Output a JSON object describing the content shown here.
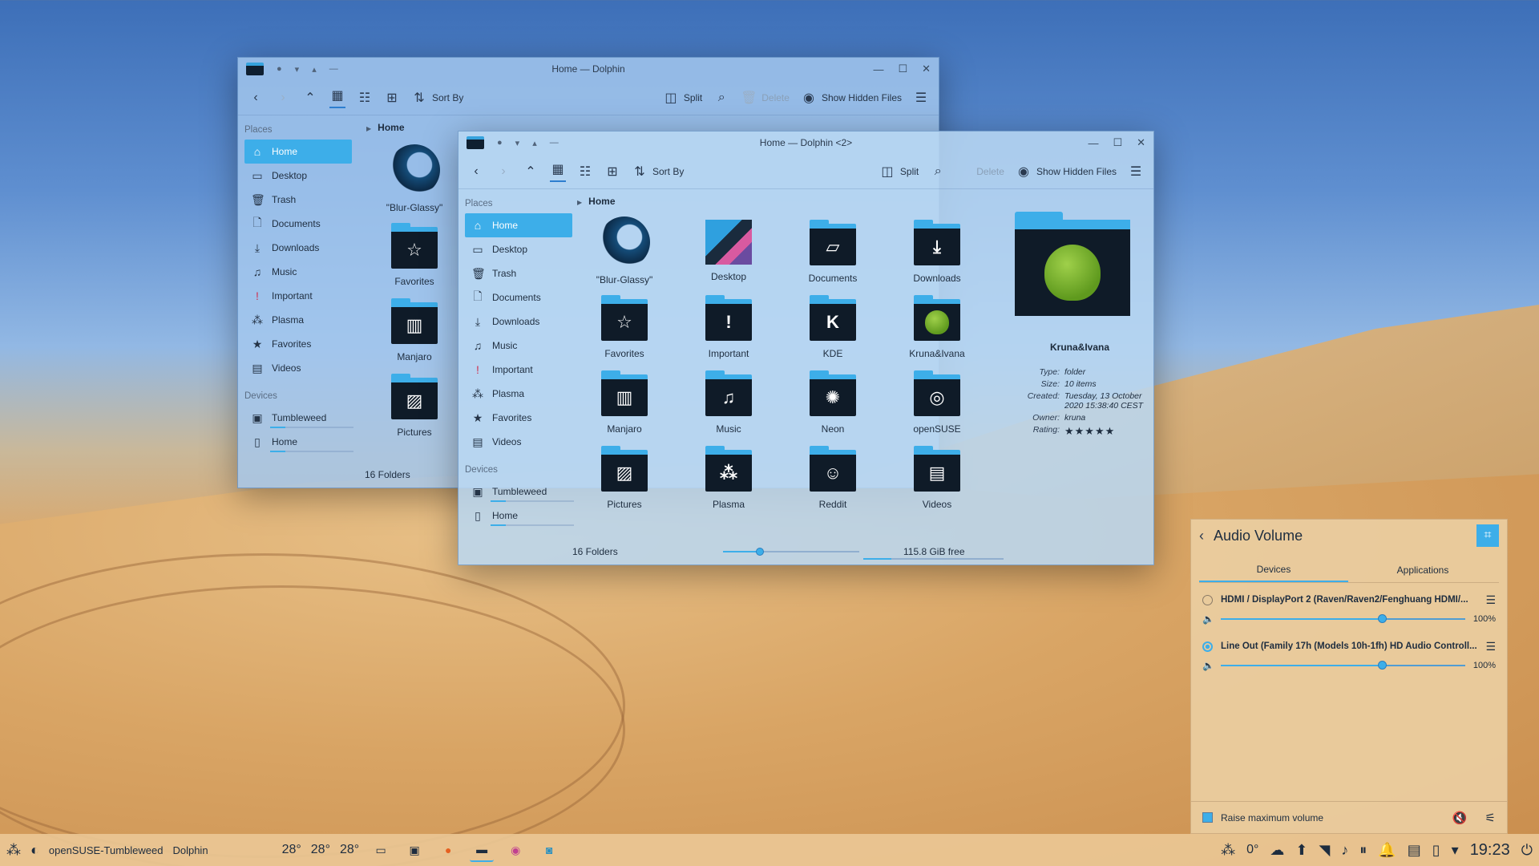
{
  "back_window": {
    "title": "Home — Dolphin",
    "toolbar": {
      "sort_by": "Sort By",
      "split": "Split",
      "delete": "Delete",
      "show_hidden": "Show Hidden Files"
    },
    "places_title": "Places",
    "places": [
      "Home",
      "Desktop",
      "Trash",
      "Documents",
      "Downloads",
      "Music",
      "Important",
      "Plasma",
      "Favorites",
      "Videos"
    ],
    "devices_title": "Devices",
    "devices": [
      "Tumbleweed",
      "Home"
    ],
    "breadcrumb": "Home",
    "items": [
      "\"Blur-Glassy\"",
      "Favorites",
      "Manjaro",
      "Pictures"
    ],
    "status": "16 Folders"
  },
  "front_window": {
    "title": "Home — Dolphin <2>",
    "toolbar": {
      "sort_by": "Sort By",
      "split": "Split",
      "delete": "Delete",
      "show_hidden": "Show Hidden Files"
    },
    "places_title": "Places",
    "places": [
      "Home",
      "Desktop",
      "Trash",
      "Documents",
      "Downloads",
      "Music",
      "Important",
      "Plasma",
      "Favorites",
      "Videos"
    ],
    "devices_title": "Devices",
    "devices": [
      "Tumbleweed",
      "Home"
    ],
    "breadcrumb": "Home",
    "items": [
      "\"Blur-Glassy\"",
      "Desktop",
      "Documents",
      "Downloads",
      "Favorites",
      "Important",
      "KDE",
      "Kruna&Ivana",
      "Manjaro",
      "Music",
      "Neon",
      "openSUSE",
      "Pictures",
      "Plasma",
      "Reddit",
      "Videos"
    ],
    "status": "16 Folders",
    "free_space": "115.8 GiB free",
    "info": {
      "name": "Kruna&Ivana",
      "type_label": "Type:",
      "type": "folder",
      "size_label": "Size:",
      "size": "10 items",
      "created_label": "Created:",
      "created": "Tuesday, 13 October 2020 15:38:40 CEST",
      "owner_label": "Owner:",
      "owner": "kruna",
      "rating_label": "Rating:",
      "rating": 5
    }
  },
  "audio": {
    "title": "Audio Volume",
    "tabs": [
      "Devices",
      "Applications"
    ],
    "devices": [
      {
        "name": "HDMI / DisplayPort 2 (Raven/Raven2/Fenghuang HDMI/...",
        "volume": "100%",
        "level": 0.66,
        "selected": false
      },
      {
        "name": "Line Out (Family 17h (Models 10h-1fh) HD Audio Controll...",
        "volume": "100%",
        "level": 0.66,
        "selected": true
      }
    ],
    "raise_max": "Raise maximum volume"
  },
  "taskbar": {
    "activity": "openSUSE-Tumbleweed",
    "app": "Dolphin",
    "temps": [
      "28°",
      "28°",
      "28°"
    ],
    "weather_temp": "0°",
    "clock": "19:23"
  }
}
